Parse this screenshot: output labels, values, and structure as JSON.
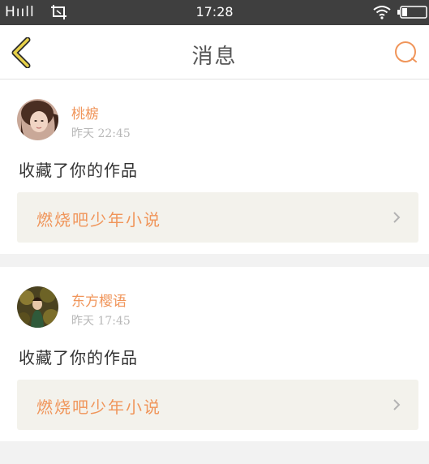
{
  "status_bar": {
    "signal": "Hııll",
    "time": "17:28"
  },
  "header": {
    "title": "消息",
    "back_icon": "chevron-left-icon",
    "search_icon": "search-icon"
  },
  "colors": {
    "accent": "#f0955a",
    "back_arrow": "#e8d24a",
    "status_bar": "#3f3f3f",
    "card_bg": "#f3f2ec"
  },
  "messages": [
    {
      "username": "桃椖",
      "time": "昨天 22:45",
      "action": "收藏了你的作品",
      "work_title": "燃烧吧少年小说"
    },
    {
      "username": "东方樱语",
      "time": "昨天 17:45",
      "action": "收藏了你的作品",
      "work_title": "燃烧吧少年小说"
    }
  ]
}
